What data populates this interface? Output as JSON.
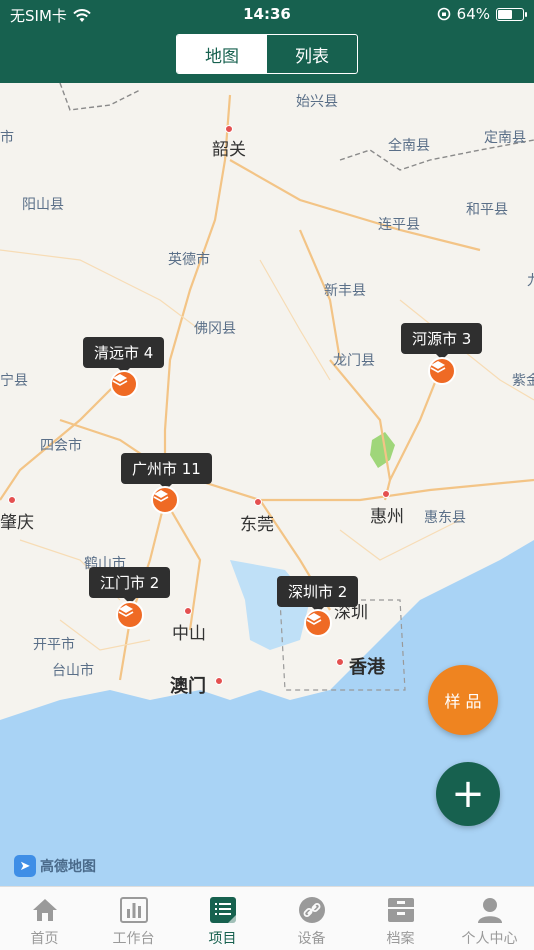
{
  "status": {
    "carrier": "无SIM卡",
    "time": "14:36",
    "battery": "64%",
    "battery_level": 0.64
  },
  "segment": {
    "options": [
      "地图",
      "列表"
    ],
    "selected": 0
  },
  "map": {
    "places": [
      {
        "name": "始兴县",
        "cls": ""
      },
      {
        "name": "韶关",
        "cls": "mid"
      },
      {
        "name": "全南县",
        "cls": ""
      },
      {
        "name": "定南县",
        "cls": ""
      },
      {
        "name": "阳山县",
        "cls": ""
      },
      {
        "name": "连平县",
        "cls": ""
      },
      {
        "name": "和平县",
        "cls": ""
      },
      {
        "name": "英德市",
        "cls": ""
      },
      {
        "name": "新丰县",
        "cls": ""
      },
      {
        "name": "佛冈县",
        "cls": ""
      },
      {
        "name": "龙门县",
        "cls": ""
      },
      {
        "name": "宁县",
        "cls": ""
      },
      {
        "name": "紫金",
        "cls": ""
      },
      {
        "name": "四会市",
        "cls": ""
      },
      {
        "name": "东莞",
        "cls": "mid"
      },
      {
        "name": "惠州",
        "cls": "mid"
      },
      {
        "name": "惠东县",
        "cls": ""
      },
      {
        "name": "肇庆",
        "cls": "mid"
      },
      {
        "name": "鹤山市",
        "cls": ""
      },
      {
        "name": "中山",
        "cls": "mid"
      },
      {
        "name": "深圳",
        "cls": "mid"
      },
      {
        "name": "开平市",
        "cls": ""
      },
      {
        "name": "台山市",
        "cls": ""
      },
      {
        "name": "香港",
        "cls": "big"
      },
      {
        "name": "澳门",
        "cls": "big"
      },
      {
        "name": "市",
        "cls": ""
      },
      {
        "name": "九",
        "cls": ""
      }
    ],
    "markers": [
      {
        "label": "清远市 4"
      },
      {
        "label": "河源市 3"
      },
      {
        "label": "广州市 11"
      },
      {
        "label": "江门市 2"
      },
      {
        "label": "深圳市 2"
      }
    ],
    "provider": "高德地图"
  },
  "fab": {
    "sample_label": "样 品",
    "add_label": "+"
  },
  "tabs": [
    {
      "label": "首页",
      "icon": "home-icon"
    },
    {
      "label": "工作台",
      "icon": "chart-icon"
    },
    {
      "label": "项目",
      "icon": "project-list-icon"
    },
    {
      "label": "设备",
      "icon": "link-icon"
    },
    {
      "label": "档案",
      "icon": "archive-icon"
    },
    {
      "label": "个人中心",
      "icon": "person-icon"
    }
  ],
  "active_tab": 2,
  "colors": {
    "brand": "#17614f",
    "accent": "#ef6a24",
    "sample": "#ef8420"
  }
}
